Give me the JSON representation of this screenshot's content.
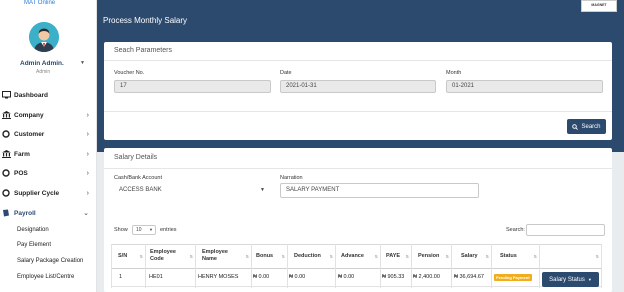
{
  "brand": {
    "text": "MAT Online"
  },
  "user": {
    "name": "Admin Admin.",
    "role": "Admin"
  },
  "nav": {
    "dashboard": "Dashboard",
    "company": "Company",
    "customer": "Customer",
    "farm": "Farm",
    "pos": "POS",
    "supplier_cycle": "Supplier Cycle",
    "payroll": "Payroll",
    "sub": [
      "Designation",
      "Pay Element",
      "Salary Package Creation",
      "Employee List/Centre"
    ]
  },
  "header": {
    "title": "Process Monthly Salary",
    "logo": "MAGNET"
  },
  "search_params": {
    "title": "Seach Parameters",
    "voucher_label": "Voucher No.",
    "voucher_value": "17",
    "date_label": "Date",
    "date_value": "2021-01-31",
    "month_label": "Month",
    "month_value": "01-2021",
    "search_button": "Search"
  },
  "salary_details": {
    "title": "Salary Details",
    "cash_label": "Cash/Bank Account",
    "cash_value": "ACCESS BANK",
    "narration_label": "Narration",
    "narration_value": "SALARY PAYMENT",
    "show_label": "Show",
    "entries_value": "10",
    "entries_label": "entries",
    "search_label": "Search:"
  },
  "table": {
    "headers": [
      "S/N",
      "Employee Code",
      "Employee Name",
      "Bonus",
      "Deduction",
      "Advance",
      "PAYE",
      "Pension",
      "Salary",
      "Status"
    ],
    "row": {
      "sn": "1",
      "code": "HE01",
      "name": "HENRY MOSES",
      "bonus": "₦ 0.00",
      "deduction": "₦ 0.00",
      "advance": "₦ 0.00",
      "paye": "₦ 905.33",
      "pension": "₦ 2,400.00",
      "salary": "₦ 36,694.67",
      "status": "Pending Payment",
      "action": "Salary Status"
    }
  },
  "colors": {
    "primary": "#2c4a6e",
    "badge": "#f0ad1d"
  }
}
